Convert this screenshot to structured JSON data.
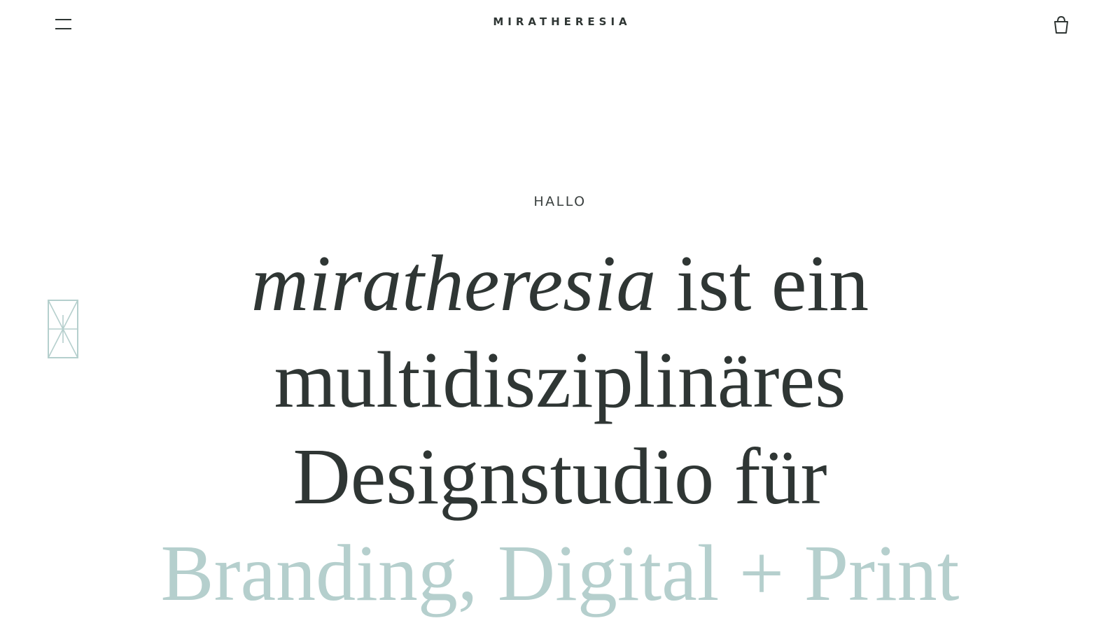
{
  "header": {
    "brand": "MIRATHERESIA",
    "menu_icon": "hamburger-menu-icon",
    "cart_icon": "shopping-basket-icon"
  },
  "decor": {
    "side_mark_icon": "geometric-star-mark-icon"
  },
  "hero": {
    "eyebrow": "HALLO",
    "line1_italic": "miratheresia",
    "line1_rest": " ist ein",
    "line2": "multidisziplinäres",
    "line3": "Designstudio für",
    "line4": "Branding, Digital + Print"
  },
  "colors": {
    "text": "#2f3634",
    "accent": "#b5cfcd",
    "background": "#ffffff"
  }
}
